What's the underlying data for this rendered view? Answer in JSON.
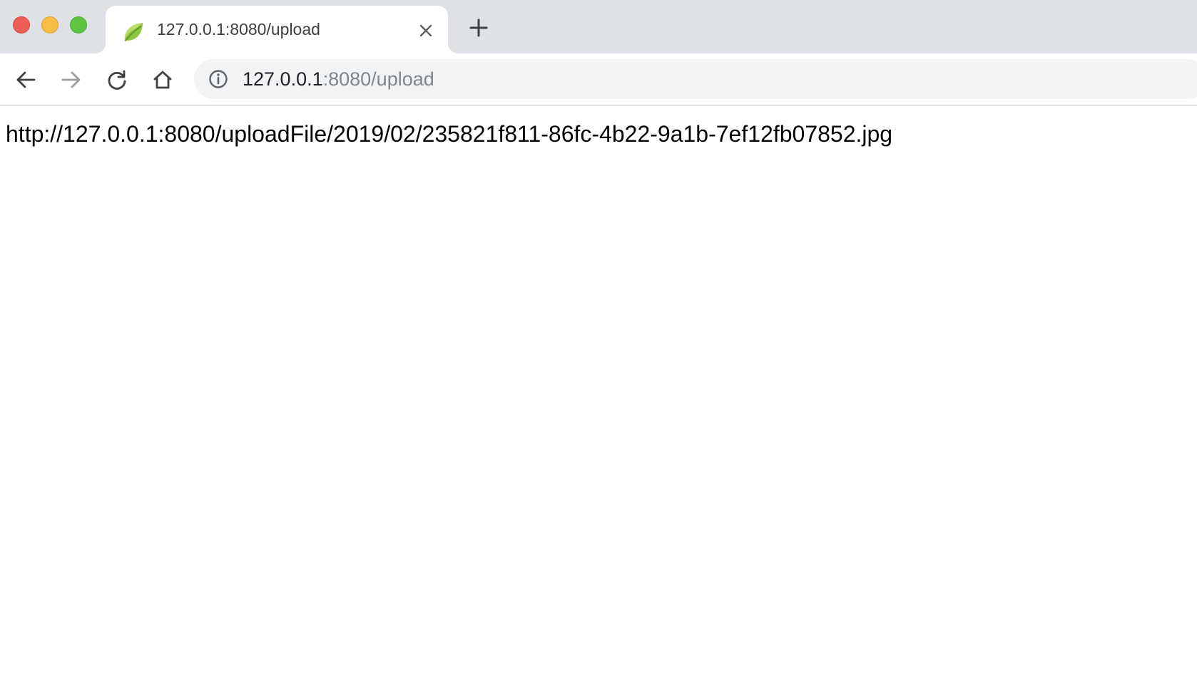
{
  "window": {
    "controls": [
      "close",
      "minimize",
      "maximize"
    ]
  },
  "tab": {
    "title": "127.0.0.1:8080/upload",
    "favicon": "spring-leaf-icon",
    "close_icon": "close-icon"
  },
  "new_tab_icon": "plus-icon",
  "toolbar": {
    "back_icon": "arrow-left-icon",
    "forward_icon": "arrow-right-icon",
    "reload_icon": "reload-icon",
    "home_icon": "home-icon"
  },
  "omnibox": {
    "info_icon": "info-icon",
    "url_host": "127.0.0.1",
    "url_rest": ":8080/upload"
  },
  "page": {
    "text": "http://127.0.0.1:8080/uploadFile/2019/02/235821f811-86fc-4b22-9a1b-7ef12fb07852.jpg"
  },
  "colors": {
    "tabstrip": "#dee1e6",
    "omnibox": "#f1f3f4",
    "url_dim": "#80868b",
    "favicon_green": "#8dc63f"
  }
}
